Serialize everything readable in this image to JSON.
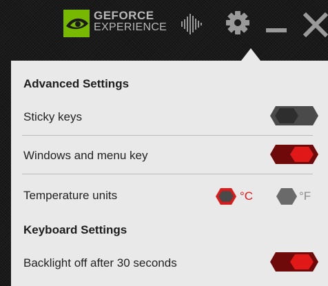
{
  "app": {
    "logo_line1": "GEFORCE",
    "logo_line2": "EXPERIENCE",
    "logo_trademark": "®"
  },
  "titlebar_icons": [
    "visualizer-icon",
    "gear-icon",
    "minimize-icon",
    "close-icon"
  ],
  "colors": {
    "accent_red": "#e01818",
    "accent_red_dark": "#6e0a0a",
    "nvidia_green": "#76b900",
    "toggle_off": "#4a4a4a",
    "panel_bg": "#e9e9e9"
  },
  "settings": {
    "advanced_heading": "Advanced Settings",
    "sticky_keys": {
      "label": "Sticky keys",
      "on": false
    },
    "windows_menu_key": {
      "label": "Windows and menu key",
      "on": true
    },
    "temperature": {
      "label": "Temperature units",
      "celsius": "°C",
      "fahrenheit": "°F",
      "selected": "C"
    },
    "keyboard_heading": "Keyboard Settings",
    "backlight": {
      "label": "Backlight off after 30 seconds",
      "on": true
    }
  }
}
